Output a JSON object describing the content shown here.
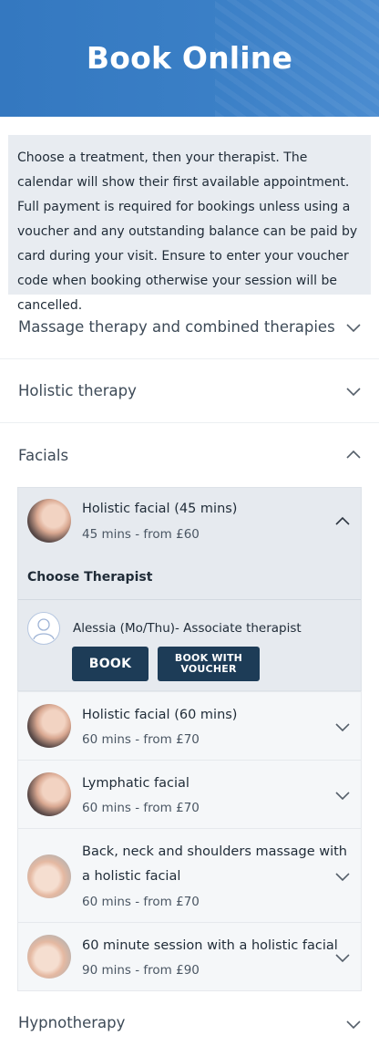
{
  "header": {
    "title": "Book Online"
  },
  "intro": {
    "text": "Choose a treatment, then your therapist. The calendar will show their first available appointment. Full payment is required for bookings unless using a voucher and any outstanding balance can be paid by card during your visit. Ensure to enter your voucher code when booking otherwise your session will be cancelled."
  },
  "categories": [
    {
      "label": "Massage therapy and combined therapies"
    },
    {
      "label": "Holistic therapy"
    },
    {
      "label": "Facials"
    },
    {
      "label": "Hypnotherapy"
    }
  ],
  "facials": {
    "selected": {
      "title": "Holistic facial (45 mins)",
      "subtitle": "45 mins - from £60",
      "choose_label": "Choose Therapist",
      "therapist": "Alessia (Mo/Thu)- Associate therapist",
      "book_label": "BOOK",
      "voucher_label_line1": "BOOK WITH",
      "voucher_label_line2": "VOUCHER"
    },
    "items": [
      {
        "title": "Holistic facial (60 mins)",
        "subtitle": "60 mins - from £70"
      },
      {
        "title": "Lymphatic facial",
        "subtitle": "60 mins - from £70"
      },
      {
        "title_line1": "Back, neck and shoulders massage with",
        "title_line2": "a holistic facial",
        "subtitle": "60 mins - from £70"
      },
      {
        "title": "60 minute session with a holistic facial",
        "subtitle": "90 mins - from £90"
      }
    ]
  },
  "icons": {
    "chevron_down": "chevron-down-icon",
    "chevron_up": "chevron-up-icon",
    "user": "user-avatar-icon"
  },
  "colors": {
    "header_blue": "#3a7fc6",
    "button_navy": "#1d3c57",
    "panel_gray": "#e6eaef"
  }
}
